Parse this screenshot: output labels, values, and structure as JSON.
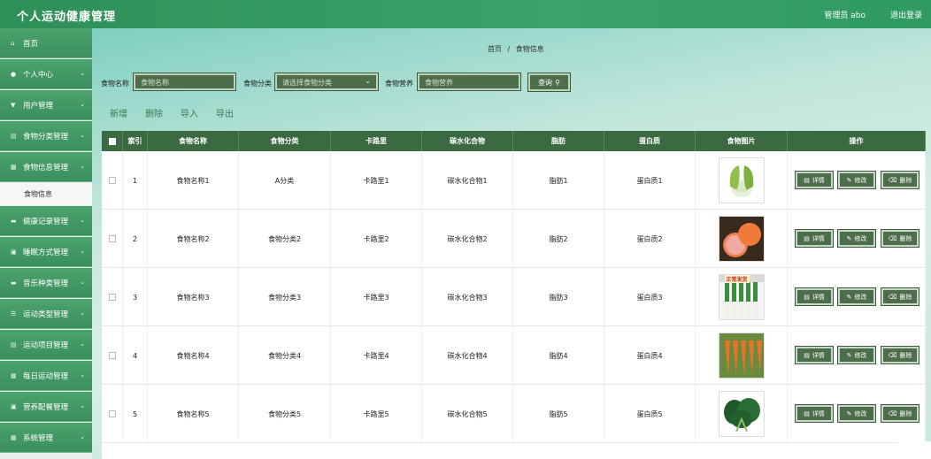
{
  "header": {
    "title": "个人运动健康管理",
    "admin": "管理员 abo",
    "logout": "退出登录"
  },
  "sidebar": {
    "items": [
      {
        "label": "首页",
        "icon": "home-icon",
        "glyph": "⌂",
        "chevron": false
      },
      {
        "label": "个人中心",
        "icon": "user-icon",
        "glyph": "●",
        "chevron": true
      },
      {
        "label": "用户管理",
        "icon": "user-manage-icon",
        "glyph": "▼",
        "chevron": true
      },
      {
        "label": "食物分类管理",
        "icon": "list-icon",
        "glyph": "▤",
        "chevron": true
      },
      {
        "label": "食物信息管理",
        "icon": "grid-icon",
        "glyph": "▦",
        "chevron": true
      },
      {
        "label": "健康记录管理",
        "icon": "doc-icon",
        "glyph": "▬",
        "chevron": true
      },
      {
        "label": "睡眠方式管理",
        "icon": "archive-icon",
        "glyph": "▣",
        "chevron": true
      },
      {
        "label": "音乐种类管理",
        "icon": "music-icon",
        "glyph": "▬",
        "chevron": true
      },
      {
        "label": "运动类型管理",
        "icon": "menu-icon",
        "glyph": "☰",
        "chevron": true
      },
      {
        "label": "运动项目管理",
        "icon": "archive-icon",
        "glyph": "▤",
        "chevron": true
      },
      {
        "label": "每日运动管理",
        "icon": "grid-icon",
        "glyph": "▦",
        "chevron": true
      },
      {
        "label": "营养配餐管理",
        "icon": "archive-icon",
        "glyph": "▣",
        "chevron": true
      },
      {
        "label": "系统管理",
        "icon": "grid-icon",
        "glyph": "▦",
        "chevron": true
      }
    ],
    "sub_item": "食物信息"
  },
  "breadcrumb": {
    "home": "首页",
    "sep": "/",
    "current": "食物信息"
  },
  "search": {
    "name_label": "食物名称",
    "name_placeholder": "食物名称",
    "category_label": "食物分类",
    "category_placeholder": "请选择食物分类",
    "nutrition_label": "食物营养",
    "nutrition_placeholder": "食物营养",
    "query_button": "查询"
  },
  "toolbar": {
    "add": "新增",
    "delete": "删除",
    "import": "导入",
    "export": "导出"
  },
  "table": {
    "headers": [
      "",
      "索引",
      "食物名称",
      "食物分类",
      "卡路里",
      "碳水化合物",
      "脂肪",
      "蛋白质",
      "食物图片",
      "操作"
    ],
    "rows": [
      {
        "index": "1",
        "name": "食物名称1",
        "category": "A分类",
        "calories": "卡路里1",
        "carbs": "碳水化合物1",
        "fat": "脂肪1",
        "protein": "蛋白质1",
        "image": "bok-choy"
      },
      {
        "index": "2",
        "name": "食物名称2",
        "category": "食物分类2",
        "calories": "卡路里2",
        "carbs": "碳水化合物2",
        "fat": "脂肪2",
        "protein": "蛋白质2",
        "image": "grapefruit"
      },
      {
        "index": "3",
        "name": "食物名称3",
        "category": "食物分类3",
        "calories": "卡路里3",
        "carbs": "碳水化合物3",
        "fat": "脂肪3",
        "protein": "蛋白质3",
        "image": "leek",
        "image_caption": "正常发货"
      },
      {
        "index": "4",
        "name": "食物名称4",
        "category": "食物分类4",
        "calories": "卡路里4",
        "carbs": "碳水化合物4",
        "fat": "脂肪4",
        "protein": "蛋白质4",
        "image": "carrot"
      },
      {
        "index": "5",
        "name": "食物名称5",
        "category": "食物分类5",
        "calories": "卡路里5",
        "carbs": "碳水化合物5",
        "fat": "脂肪5",
        "protein": "蛋白质5",
        "image": "spinach"
      }
    ],
    "actions": {
      "detail": "详情",
      "edit": "修改",
      "delete": "删除"
    }
  },
  "colors": {
    "header": "#3aa36a",
    "sidebar": "#4ca36d",
    "table_head": "#3b6a42",
    "button": "#4e6d4a"
  }
}
